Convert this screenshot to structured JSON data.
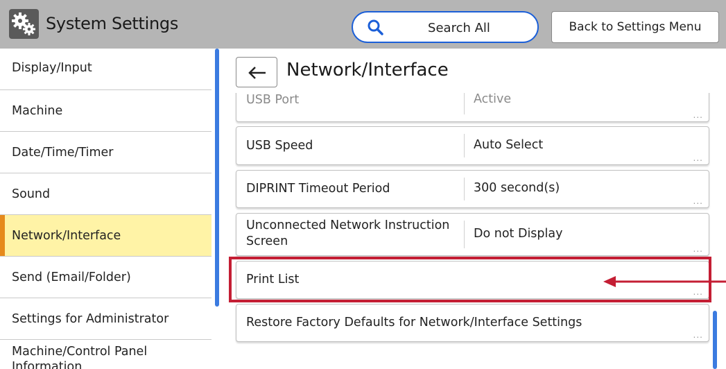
{
  "header": {
    "title": "System Settings",
    "search_label": "Search All",
    "back_menu_label": "Back to Settings Menu"
  },
  "sidebar": {
    "items": [
      {
        "label": "Display/Input",
        "selected": false
      },
      {
        "label": "Machine",
        "selected": false
      },
      {
        "label": "Date/Time/Timer",
        "selected": false
      },
      {
        "label": "Sound",
        "selected": false
      },
      {
        "label": "Network/Interface",
        "selected": true
      },
      {
        "label": "Send (Email/Folder)",
        "selected": false
      },
      {
        "label": "Settings for Administrator",
        "selected": false
      },
      {
        "label": "Machine/Control Panel Information",
        "selected": false
      }
    ]
  },
  "main": {
    "title": "Network/Interface",
    "rows": [
      {
        "label": "USB Port",
        "value": "Active",
        "dots": "..."
      },
      {
        "label": "USB Speed",
        "value": "Auto Select",
        "dots": "..."
      },
      {
        "label": "DIPRINT Timeout Period",
        "value": "300 second(s)",
        "dots": "..."
      },
      {
        "label": "Unconnected Network Instruction Screen",
        "value": "Do not Display",
        "dots": "..."
      },
      {
        "label": "Print List",
        "value": "",
        "dots": "..."
      },
      {
        "label": "Restore Factory Defaults for Network/Interface Settings",
        "value": "",
        "dots": "..."
      }
    ]
  },
  "icons": {
    "app": "gears-icon",
    "search": "magnifier-icon",
    "back": "left-arrow-icon"
  },
  "colors": {
    "header_bg": "#b5b5b5",
    "accent_blue": "#1b5fd8",
    "selected_bg": "#fff3a6",
    "selected_marker": "#e68a1c",
    "annotation_red": "#c41e34"
  }
}
